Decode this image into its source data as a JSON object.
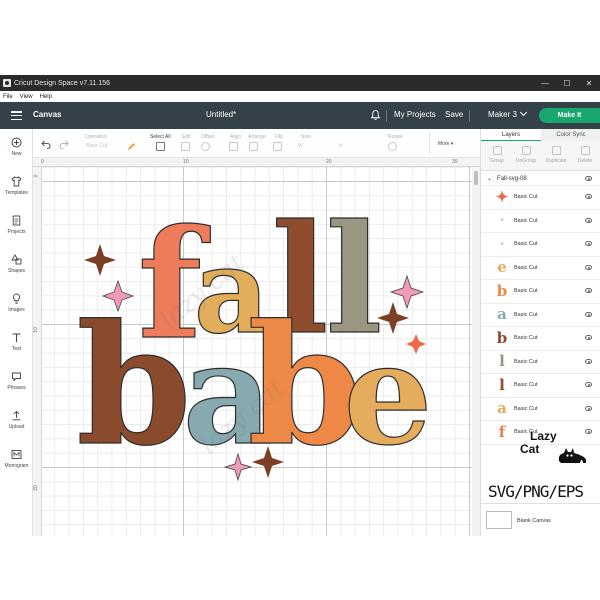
{
  "window": {
    "title": "Cricut Design Space  v7.11.156",
    "controls": [
      "—",
      "☐",
      "✕"
    ]
  },
  "menu": [
    "File",
    "View",
    "Help"
  ],
  "nav": {
    "section": "Canvas",
    "document": "Untitled*",
    "my_projects": "My Projects",
    "save": "Save",
    "machine": "Maker 3",
    "make_it": "Make It"
  },
  "left_tools": [
    {
      "label": "New",
      "icon": "plus-circle-icon"
    },
    {
      "label": "Templates",
      "icon": "shirt-icon"
    },
    {
      "label": "Projects",
      "icon": "document-icon"
    },
    {
      "label": "Shapes",
      "icon": "shapes-icon"
    },
    {
      "label": "Images",
      "icon": "bulb-icon"
    },
    {
      "label": "Text",
      "icon": "text-icon"
    },
    {
      "label": "Phrases",
      "icon": "speech-icon"
    },
    {
      "label": "Upload",
      "icon": "upload-icon"
    },
    {
      "label": "Monogram",
      "icon": "monogram-icon"
    }
  ],
  "toolbar": {
    "operation_label": "Operation",
    "operation_value": "Basic Cut",
    "select_all": "Select All",
    "edit": "Edit",
    "offset": "Offset",
    "align": "Align",
    "arrange": "Arrange",
    "flip": "Flip",
    "size": "Size",
    "rotate": "Rotate",
    "width_short": "W",
    "height_short": "H",
    "more": "More"
  },
  "rulers": {
    "top": [
      "0",
      "10",
      "20",
      "30"
    ],
    "left": [
      "0",
      "10",
      "20"
    ]
  },
  "artwork": {
    "line1": [
      "f",
      "a",
      "l",
      "l"
    ],
    "line2": [
      "b",
      "a",
      "b",
      "e"
    ],
    "colors": {
      "f": "#ee7b5a",
      "a1": "#e2ae5b",
      "l1": "#8f4d2e",
      "l2": "#9a9682",
      "b1": "#8a4a2c",
      "a2": "#86aab0",
      "b2": "#ee8846",
      "e": "#e6ac5d",
      "sparkle_dark": "#7a3f24",
      "sparkle_pink": "#f19bb6",
      "sparkle_orange": "#eb6b46"
    }
  },
  "panel": {
    "tabs": [
      "Layers",
      "Color Sync"
    ],
    "actions": [
      "Group",
      "UnGroup",
      "Duplicate",
      "Delete"
    ],
    "group_name": "Fall-svg-08",
    "layers": [
      {
        "glyph": "✦",
        "color": "#eb6b46",
        "name": "Basic Cut"
      },
      {
        "glyph": "·",
        "color": "#c8c8c8",
        "name": "Basic Cut"
      },
      {
        "glyph": "·",
        "color": "#c8c8c8",
        "name": "Basic Cut"
      },
      {
        "glyph": "e",
        "color": "#e6ac5d",
        "name": "Basic Cut"
      },
      {
        "glyph": "b",
        "color": "#ee8846",
        "name": "Basic Cut"
      },
      {
        "glyph": "a",
        "color": "#86aab0",
        "name": "Basic Cut"
      },
      {
        "glyph": "b",
        "color": "#8a4a2c",
        "name": "Basic Cut"
      },
      {
        "glyph": "l",
        "color": "#9a9682",
        "name": "Basic Cut"
      },
      {
        "glyph": "l",
        "color": "#8f4d2e",
        "name": "Basic Cut"
      },
      {
        "glyph": "a",
        "color": "#e2ae5b",
        "name": "Basic Cut"
      },
      {
        "glyph": "f",
        "color": "#ee7b5a",
        "name": "Basic Cut"
      }
    ],
    "blank_canvas": "Blank Canvas"
  },
  "branding": {
    "brand_line1": "Lazy",
    "brand_line2": "Cat",
    "product_formats": "SVG/PNG/EPS",
    "watermark": "lazy cat"
  }
}
